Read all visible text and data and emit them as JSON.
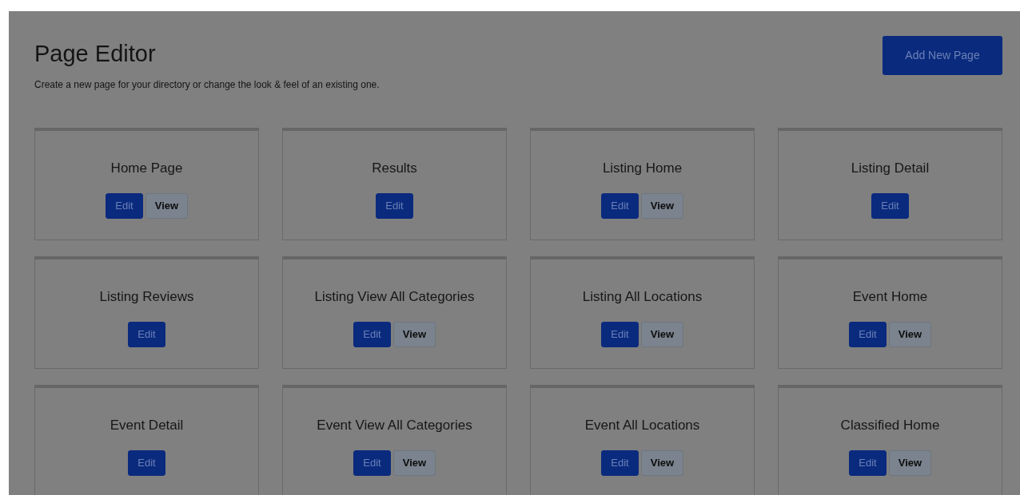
{
  "header": {
    "title": "Page Editor",
    "subtitle": "Create a new page for your directory or change the look & feel of an existing one.",
    "add_button": "Add New Page"
  },
  "pages": [
    {
      "title": "Home Page",
      "buttons": [
        {
          "kind": "edit",
          "label": "Edit"
        },
        {
          "kind": "view",
          "label": "View"
        }
      ]
    },
    {
      "title": "Results",
      "buttons": [
        {
          "kind": "edit",
          "label": "Edit"
        }
      ]
    },
    {
      "title": "Listing Home",
      "buttons": [
        {
          "kind": "edit",
          "label": "Edit"
        },
        {
          "kind": "view",
          "label": "View"
        }
      ]
    },
    {
      "title": "Listing Detail",
      "buttons": [
        {
          "kind": "edit",
          "label": "Edit"
        }
      ]
    },
    {
      "title": "Listing Reviews",
      "buttons": [
        {
          "kind": "edit",
          "label": "Edit"
        }
      ]
    },
    {
      "title": "Listing View All Categories",
      "buttons": [
        {
          "kind": "edit",
          "label": "Edit"
        },
        {
          "kind": "view",
          "label": "View"
        }
      ]
    },
    {
      "title": "Listing All Locations",
      "buttons": [
        {
          "kind": "edit",
          "label": "Edit"
        },
        {
          "kind": "view",
          "label": "View"
        }
      ]
    },
    {
      "title": "Event Home",
      "buttons": [
        {
          "kind": "edit",
          "label": "Edit"
        },
        {
          "kind": "view",
          "label": "View"
        }
      ]
    },
    {
      "title": "Event Detail",
      "buttons": [
        {
          "kind": "edit",
          "label": "Edit"
        }
      ]
    },
    {
      "title": "Event View All Categories",
      "buttons": [
        {
          "kind": "edit",
          "label": "Edit"
        },
        {
          "kind": "view",
          "label": "View"
        }
      ]
    },
    {
      "title": "Event All Locations",
      "buttons": [
        {
          "kind": "edit",
          "label": "Edit"
        },
        {
          "kind": "view",
          "label": "View"
        }
      ]
    },
    {
      "title": "Classified Home",
      "buttons": [
        {
          "kind": "edit",
          "label": "Edit"
        },
        {
          "kind": "view",
          "label": "View"
        }
      ]
    }
  ]
}
